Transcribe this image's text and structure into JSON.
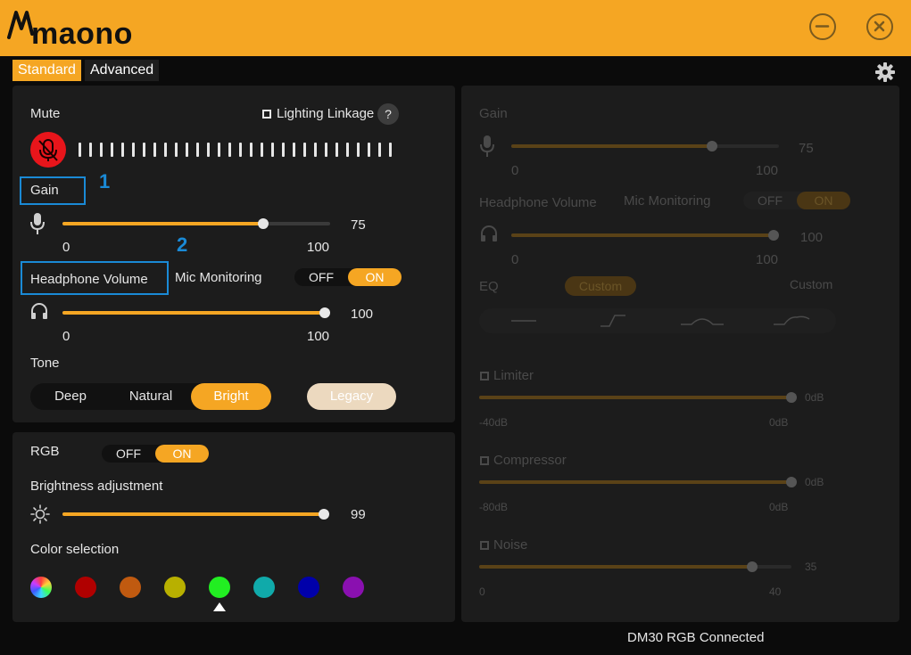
{
  "app": {
    "logo_text": "maono",
    "accent": "#f5a623"
  },
  "tabs": {
    "standard": "Standard",
    "advanced": "Advanced"
  },
  "left": {
    "mute_label": "Mute",
    "lighting_label": "Lighting Linkage",
    "help_glyph": "?",
    "gain_label": "Gain",
    "gain": {
      "value": 75,
      "min_label": "0",
      "max_label": "100",
      "value_label": "75"
    },
    "annotation_1": "1",
    "annotation_2": "2",
    "headphone_label": "Headphone Volume",
    "mic_monitoring_label": "Mic Monitoring",
    "mic_monitoring": {
      "off": "OFF",
      "on": "ON",
      "state": "ON"
    },
    "headphone": {
      "value": 100,
      "min_label": "0",
      "max_label": "100",
      "value_label": "100"
    },
    "tone_label": "Tone",
    "tone_options": [
      "Deep",
      "Natural",
      "Bright"
    ],
    "tone_selected": "Bright",
    "legacy_label": "Legacy"
  },
  "rgb": {
    "rgb_label": "RGB",
    "toggle": {
      "off": "OFF",
      "on": "ON",
      "state": "ON"
    },
    "brightness_label": "Brightness adjustment",
    "brightness": {
      "value": 99,
      "value_label": "99"
    },
    "color_label": "Color selection",
    "colors": [
      "rainbow",
      "#b00000",
      "#c05a10",
      "#b8b000",
      "#22ee22",
      "#10aaaa",
      "#0000aa",
      "#8a10b0"
    ],
    "selected_color": "#22ee22"
  },
  "right": {
    "gain_label": "Gain",
    "gain": {
      "value": 75,
      "min_label": "0",
      "max_label": "100",
      "value_label": "75"
    },
    "headphone_label": "Headphone Volume",
    "mic_monitoring_label": "Mic Monitoring",
    "mic_monitoring": {
      "off": "OFF",
      "on": "ON"
    },
    "headphone": {
      "value": 100,
      "min_label": "0",
      "max_label": "100",
      "value_label": "100"
    },
    "eq_label": "EQ",
    "eq_pill": "Custom",
    "eq_custom_label": "Custom",
    "limiter_label": "Limiter",
    "limiter": {
      "value": 0,
      "min_label": "-40dB",
      "max_label": "0dB",
      "value_label": "0dB"
    },
    "compressor_label": "Compressor",
    "compressor": {
      "value": 0,
      "min_label": "-80dB",
      "max_label": "0dB",
      "value_label": "0dB"
    },
    "noise_label": "Noise",
    "noise": {
      "value": 35,
      "min_label": "0",
      "max_label": "40",
      "value_label": "35"
    }
  },
  "status_text": "DM30 RGB Connected"
}
